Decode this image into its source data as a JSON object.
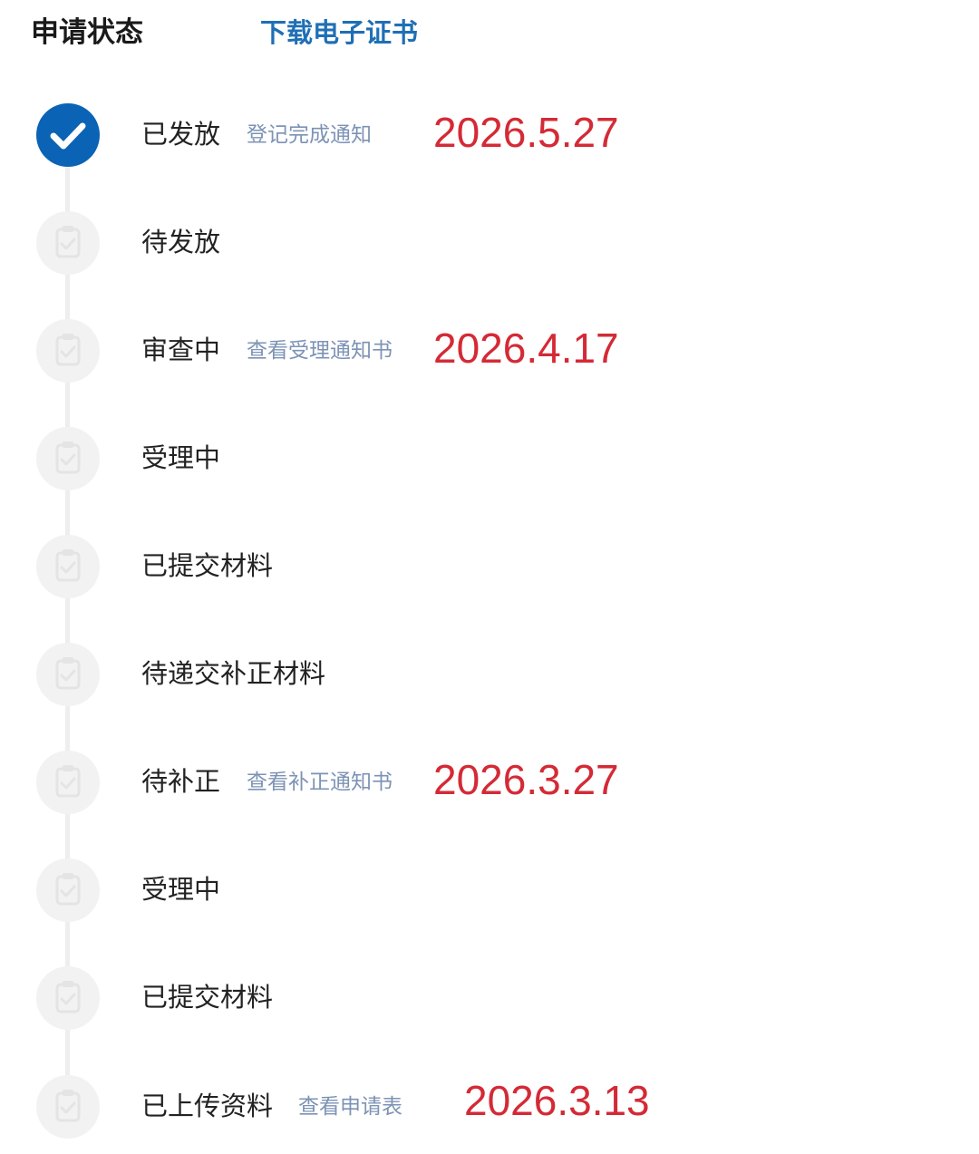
{
  "header": {
    "title": "申请状态",
    "download_link": "下载电子证书"
  },
  "steps": [
    {
      "label": "已发放",
      "link": "登记完成通知",
      "date": "2026.5.27",
      "status": "done"
    },
    {
      "label": "待发放",
      "status": "pending"
    },
    {
      "label": "审查中",
      "link": "查看受理通知书",
      "date": "2026.4.17",
      "status": "pending"
    },
    {
      "label": "受理中",
      "status": "pending"
    },
    {
      "label": "已提交材料",
      "status": "pending"
    },
    {
      "label": "待递交补正材料",
      "status": "pending"
    },
    {
      "label": "待补正",
      "link": "查看补正通知书",
      "date": "2026.3.27",
      "status": "pending"
    },
    {
      "label": "受理中",
      "status": "pending"
    },
    {
      "label": "已提交材料",
      "status": "pending"
    },
    {
      "label": "已上传资料",
      "link": "查看申请表",
      "date": "2026.3.13",
      "status": "pending"
    }
  ],
  "icons": {
    "done": "check-circle-icon",
    "pending": "clipboard-check-icon"
  },
  "colors": {
    "done": "#0a63b4",
    "pending": "#f2f2f2",
    "link": "#7c93b5",
    "date": "#d42a36",
    "download": "#1f6fb5"
  }
}
